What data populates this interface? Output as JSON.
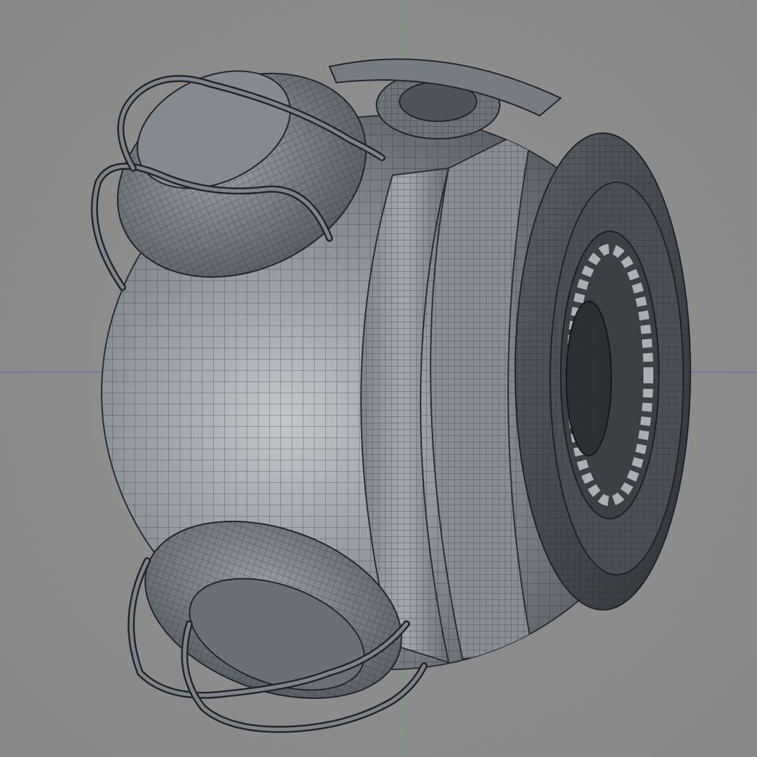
{
  "viewport": {
    "background_color": "#8d8d8d",
    "axis_x_color": "#6b6bb0",
    "axis_y_color": "#5fae5f",
    "mesh_fill_color": "#5f656c",
    "mesh_dark_color": "#3a3f45",
    "mesh_light_color": "#a9b0b6",
    "wire_color": "#22262a"
  },
  "model": {
    "icon": "3d-model-wireframe-sphere-robot",
    "parts": [
      "sphere-body",
      "center-band",
      "eye-ring",
      "eye-lens",
      "top-handle-plate",
      "bottom-handle-plate",
      "top-button",
      "upper-cables",
      "lower-cables"
    ]
  }
}
